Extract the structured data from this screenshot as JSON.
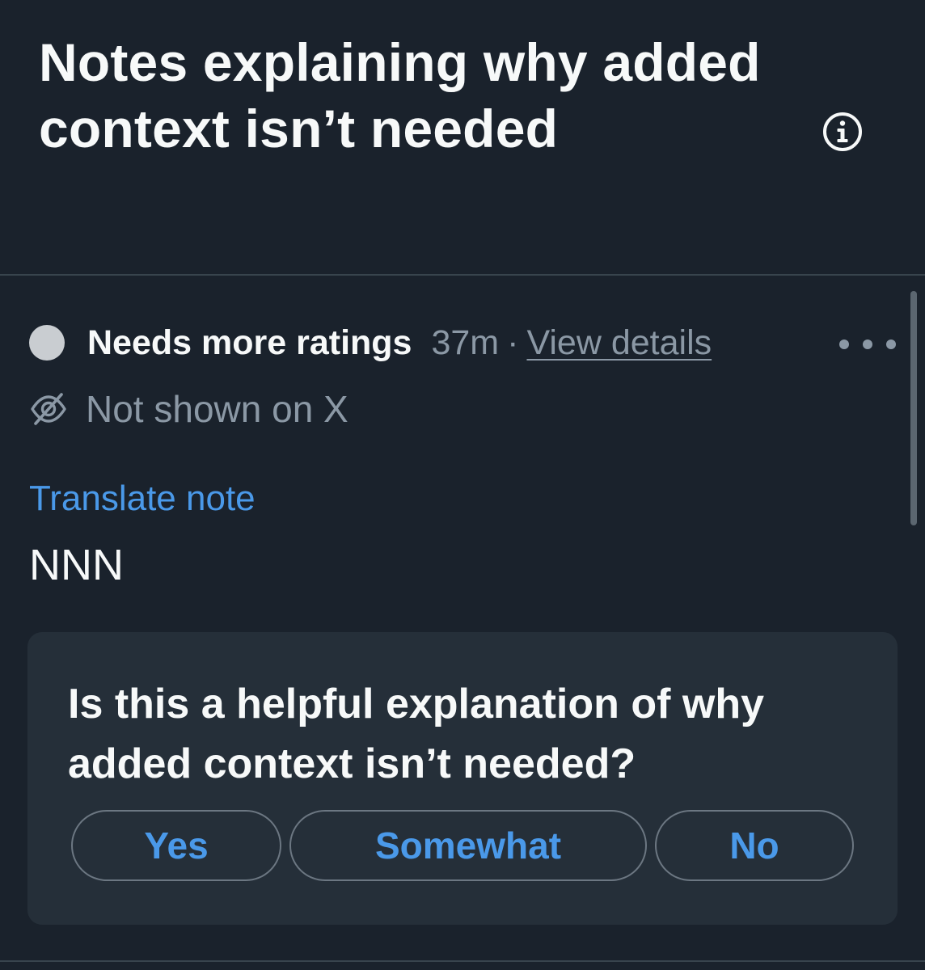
{
  "header": {
    "title": "Notes explaining why added context isn’t needed",
    "info_icon": "info-circle-icon"
  },
  "note": {
    "status_label": "Needs more ratings",
    "time": "37m",
    "separator": "·",
    "view_details": "View details",
    "more_icon": "more-horizontal-icon",
    "visibility_icon": "eye-off-icon",
    "visibility": "Not shown on X",
    "translate_link": "Translate note",
    "text": "NNN"
  },
  "rating": {
    "question": "Is this a helpful explanation of why added context isn’t needed?",
    "options": [
      "Yes",
      "Somewhat",
      "No"
    ]
  },
  "colors": {
    "background": "#1a222c",
    "card": "#252f39",
    "link": "#4a99e9",
    "muted": "#8b98a5",
    "text": "#f7f9f9",
    "status_dot": "#c9cdd1"
  }
}
